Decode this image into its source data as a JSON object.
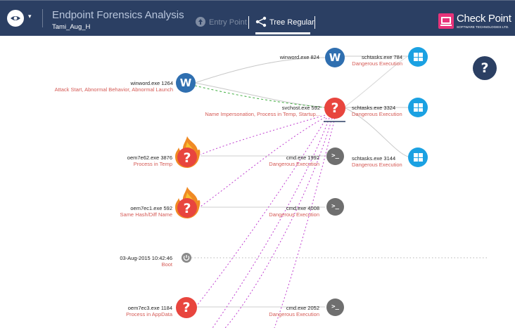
{
  "header": {
    "title": "Endpoint Forensics Analysis",
    "subtitle": "Tami_Aug_H",
    "tabs": [
      {
        "label": "Entry Point",
        "active": false
      },
      {
        "label": "Tree Regular",
        "active": true
      }
    ],
    "logo": {
      "name": "Check Point",
      "tagline": "SOFTWARE TECHNOLOGIES LTD."
    }
  },
  "colors": {
    "header_bg": "#2b3f63",
    "word_blue": "#2f6fb0",
    "windows_blue": "#1ba1e2",
    "alert_red": "#e8453e",
    "cmd_gray": "#6f6f6f",
    "edge_purple": "#c040d0",
    "edge_green": "#3fae3f",
    "desc_red": "#d55a55"
  },
  "help": {
    "label": "?"
  },
  "nodes": {
    "winword_824": {
      "name": "winword.exe 824",
      "desc": "",
      "icon": "word-icon"
    },
    "winword_1264": {
      "name": "winword.exe 1264",
      "desc": "Attack Start, Abnormal Behavior, Abnormal Launch",
      "icon": "word-icon"
    },
    "svchost_592": {
      "name": "svchost.exe 592",
      "desc": "Name Impersonation, Process in Temp, Startup...",
      "icon": "question-icon"
    },
    "schtasks_784": {
      "name": "schtasks.exe 784",
      "desc": "Dangerous Execution",
      "icon": "windows-icon"
    },
    "schtasks_3324": {
      "name": "schtasks.exe 3324",
      "desc": "Dangerous Execution",
      "icon": "windows-icon"
    },
    "schtasks_3144": {
      "name": "schtasks.exe 3144",
      "desc": "Dangerous Execution",
      "icon": "windows-icon"
    },
    "oem7e62_3876": {
      "name": "oem7e62.exe 3876",
      "desc": "Process in Temp",
      "icon": "flame-question-icon"
    },
    "cmd_1992": {
      "name": "cmd.exe 1992",
      "desc": "Dangerous Execution",
      "icon": "cmd-icon"
    },
    "oem7ec1_592": {
      "name": "oem7ec1.exe 592",
      "desc": "Same Hash/Diff Name",
      "icon": "flame-question-icon"
    },
    "cmd_4008": {
      "name": "cmd.exe 4008",
      "desc": "Dangerous Execution",
      "icon": "cmd-icon"
    },
    "boot": {
      "name": "03-Aug-2015 10:42:46",
      "desc": "Boot",
      "icon": "power-icon"
    },
    "oem7ec3_1184": {
      "name": "oem7ec3.exe 1184",
      "desc": "Process in AppData",
      "icon": "question-icon"
    },
    "cmd_2052": {
      "name": "cmd.exe 2052",
      "desc": "Dangerous Execution",
      "icon": "cmd-icon"
    }
  }
}
